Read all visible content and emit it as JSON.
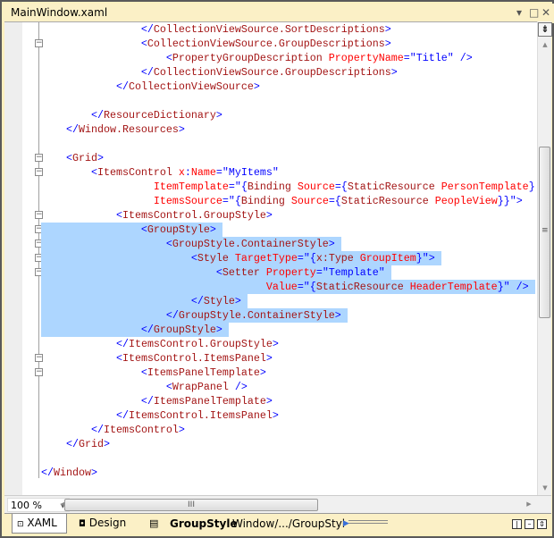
{
  "window": {
    "title": "MainWindow.xaml",
    "buttons": {
      "dropdown": "▾",
      "maximize": "□",
      "close": "✕"
    }
  },
  "code_lines": [
    [
      [
        16,
        ""
      ],
      [
        "b",
        "</"
      ],
      [
        "t",
        "CollectionViewSource.SortDescriptions"
      ],
      [
        "b",
        ">"
      ]
    ],
    [
      [
        16,
        ""
      ],
      [
        "b",
        "<"
      ],
      [
        "t",
        "CollectionViewSource.GroupDescriptions"
      ],
      [
        "b",
        ">"
      ]
    ],
    [
      [
        20,
        ""
      ],
      [
        "b",
        "<"
      ],
      [
        "t",
        "PropertyGroupDescription"
      ],
      [
        "a",
        " PropertyName"
      ],
      [
        "b",
        "="
      ],
      [
        "v",
        "\"Title\""
      ],
      [
        "b",
        " />"
      ]
    ],
    [
      [
        16,
        ""
      ],
      [
        "b",
        "</"
      ],
      [
        "t",
        "CollectionViewSource.GroupDescriptions"
      ],
      [
        "b",
        ">"
      ]
    ],
    [
      [
        12,
        ""
      ],
      [
        "b",
        "</"
      ],
      [
        "t",
        "CollectionViewSource"
      ],
      [
        "b",
        ">"
      ]
    ],
    [
      [
        0,
        ""
      ]
    ],
    [
      [
        8,
        ""
      ],
      [
        "b",
        "</"
      ],
      [
        "t",
        "ResourceDictionary"
      ],
      [
        "b",
        ">"
      ]
    ],
    [
      [
        4,
        ""
      ],
      [
        "b",
        "</"
      ],
      [
        "t",
        "Window.Resources"
      ],
      [
        "b",
        ">"
      ]
    ],
    [
      [
        0,
        ""
      ]
    ],
    [
      [
        4,
        ""
      ],
      [
        "b",
        "<"
      ],
      [
        "t",
        "Grid"
      ],
      [
        "b",
        ">"
      ]
    ],
    [
      [
        8,
        ""
      ],
      [
        "b",
        "<"
      ],
      [
        "t",
        "ItemsControl"
      ],
      [
        "a",
        " x"
      ],
      [
        "b",
        ":"
      ],
      [
        "a",
        "Name"
      ],
      [
        "b",
        "="
      ],
      [
        "v",
        "\"MyItems\""
      ]
    ],
    [
      [
        18,
        ""
      ],
      [
        "a",
        "ItemTemplate"
      ],
      [
        "b",
        "=\"{"
      ],
      [
        "t",
        "Binding"
      ],
      [
        "a",
        " Source"
      ],
      [
        "b",
        "={"
      ],
      [
        "t",
        "StaticResource"
      ],
      [
        "a",
        " PersonTemplate"
      ],
      [
        "b",
        "}"
      ]
    ],
    [
      [
        18,
        ""
      ],
      [
        "a",
        "ItemsSource"
      ],
      [
        "b",
        "=\"{"
      ],
      [
        "t",
        "Binding"
      ],
      [
        "a",
        " Source"
      ],
      [
        "b",
        "={"
      ],
      [
        "t",
        "StaticResource"
      ],
      [
        "a",
        " PeopleView"
      ],
      [
        "b",
        "}}\">"
      ]
    ],
    [
      [
        12,
        ""
      ],
      [
        "b",
        "<"
      ],
      [
        "t",
        "ItemsControl.GroupStyle"
      ],
      [
        "b",
        ">"
      ]
    ],
    [
      [
        16,
        "sel"
      ],
      [
        "b",
        "<"
      ],
      [
        "t",
        "GroupStyle"
      ],
      [
        "b",
        ">"
      ]
    ],
    [
      [
        20,
        "sel"
      ],
      [
        "b",
        "<"
      ],
      [
        "t",
        "GroupStyle.ContainerStyle"
      ],
      [
        "b",
        ">"
      ]
    ],
    [
      [
        24,
        "sel"
      ],
      [
        "b",
        "<"
      ],
      [
        "t",
        "Style"
      ],
      [
        "a",
        " TargetType"
      ],
      [
        "b",
        "=\"{"
      ],
      [
        "t",
        "x:Type"
      ],
      [
        "a",
        " GroupItem"
      ],
      [
        "b",
        "}\">"
      ]
    ],
    [
      [
        28,
        "sel"
      ],
      [
        "b",
        "<"
      ],
      [
        "t",
        "Setter"
      ],
      [
        "a",
        " Property"
      ],
      [
        "b",
        "="
      ],
      [
        "v",
        "\"Template\""
      ]
    ],
    [
      [
        36,
        "sel"
      ],
      [
        "a",
        "Value"
      ],
      [
        "b",
        "=\"{"
      ],
      [
        "t",
        "StaticResource"
      ],
      [
        "a",
        " HeaderTemplate"
      ],
      [
        "b",
        "}\" />"
      ]
    ],
    [
      [
        24,
        "sel"
      ],
      [
        "b",
        "</"
      ],
      [
        "t",
        "Style"
      ],
      [
        "b",
        ">"
      ]
    ],
    [
      [
        20,
        "sel"
      ],
      [
        "b",
        "</"
      ],
      [
        "t",
        "GroupStyle.ContainerStyle"
      ],
      [
        "b",
        ">"
      ]
    ],
    [
      [
        16,
        "sel"
      ],
      [
        "b",
        "</"
      ],
      [
        "t",
        "GroupStyle"
      ],
      [
        "b",
        ">"
      ]
    ],
    [
      [
        12,
        ""
      ],
      [
        "b",
        "</"
      ],
      [
        "t",
        "ItemsControl.GroupStyle"
      ],
      [
        "b",
        ">"
      ]
    ],
    [
      [
        12,
        ""
      ],
      [
        "b",
        "<"
      ],
      [
        "t",
        "ItemsControl.ItemsPanel"
      ],
      [
        "b",
        ">"
      ]
    ],
    [
      [
        16,
        ""
      ],
      [
        "b",
        "<"
      ],
      [
        "t",
        "ItemsPanelTemplate"
      ],
      [
        "b",
        ">"
      ]
    ],
    [
      [
        20,
        ""
      ],
      [
        "b",
        "<"
      ],
      [
        "t",
        "WrapPanel"
      ],
      [
        "b",
        " />"
      ]
    ],
    [
      [
        16,
        ""
      ],
      [
        "b",
        "</"
      ],
      [
        "t",
        "ItemsPanelTemplate"
      ],
      [
        "b",
        ">"
      ]
    ],
    [
      [
        12,
        ""
      ],
      [
        "b",
        "</"
      ],
      [
        "t",
        "ItemsControl.ItemsPanel"
      ],
      [
        "b",
        ">"
      ]
    ],
    [
      [
        8,
        ""
      ],
      [
        "b",
        "</"
      ],
      [
        "t",
        "ItemsControl"
      ],
      [
        "b",
        ">"
      ]
    ],
    [
      [
        4,
        ""
      ],
      [
        "b",
        "</"
      ],
      [
        "t",
        "Grid"
      ],
      [
        "b",
        ">"
      ]
    ],
    [
      [
        0,
        ""
      ]
    ],
    [
      [
        0,
        ""
      ],
      [
        "b",
        "</"
      ],
      [
        "t",
        "Window"
      ],
      [
        "b",
        ">"
      ]
    ]
  ],
  "fold_markers": [
    1,
    9,
    10,
    13,
    14,
    15,
    16,
    17,
    23,
    24
  ],
  "zoom": {
    "value": "100 %"
  },
  "tabs": {
    "xaml": "XAML",
    "design": "Design"
  },
  "breadcrumb": {
    "current": "GroupStyle",
    "path": "Window/.../GroupStyl"
  },
  "colors": {
    "selection": "#add6ff",
    "tag": "#a31515",
    "attribute": "#ff0000",
    "punct": "#0000ff"
  }
}
